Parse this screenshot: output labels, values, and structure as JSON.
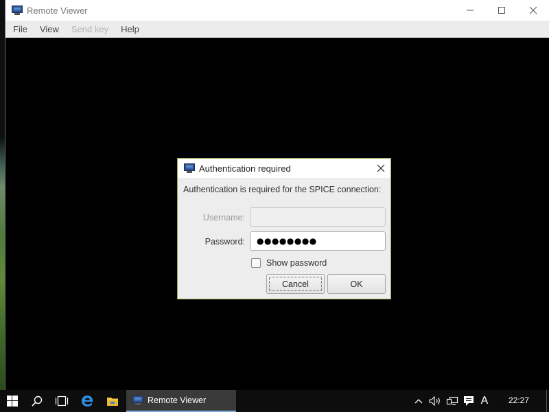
{
  "window": {
    "title": "Remote Viewer",
    "app_icon": "monitor-icon",
    "controls": [
      "minimize-icon",
      "maximize-icon",
      "close-icon"
    ]
  },
  "menubar": {
    "items": [
      {
        "label": "File",
        "enabled": true
      },
      {
        "label": "View",
        "enabled": true
      },
      {
        "label": "Send key",
        "enabled": false
      },
      {
        "label": "Help",
        "enabled": true
      }
    ]
  },
  "dialog": {
    "title": "Authentication required",
    "message": "Authentication is required for the SPICE connection:",
    "username_label": "Username:",
    "username_value": "",
    "password_label": "Password:",
    "password_masked": "●●●●●●●●",
    "show_password_label": "Show password",
    "show_password_checked": false,
    "cancel_label": "Cancel",
    "ok_label": "OK"
  },
  "taskbar": {
    "pinned": [
      "windows-start-icon",
      "search-icon",
      "task-view-icon",
      "edge-icon",
      "file-explorer-icon"
    ],
    "active_app_label": "Remote Viewer",
    "tray": [
      "chevron-up-icon",
      "volume-icon",
      "network-icon",
      "action-center-icon"
    ],
    "ime_indicator": "A",
    "clock": "22:27",
    "accent": "#7fb0e0"
  },
  "colors": {
    "dialog_border": "#9aa24a",
    "display_background": "#000000"
  }
}
